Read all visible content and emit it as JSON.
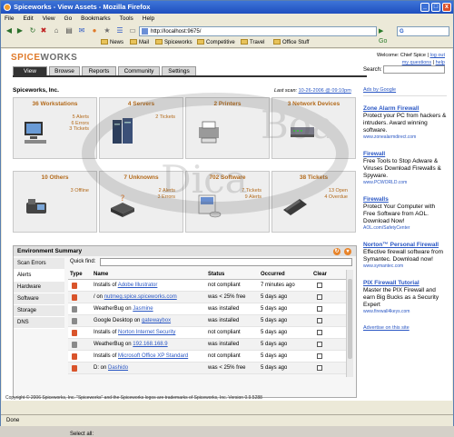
{
  "window": {
    "title": "Spiceworks - View Assets - Mozilla Firefox"
  },
  "menu": [
    "File",
    "Edit",
    "View",
    "Go",
    "Bookmarks",
    "Tools",
    "Help"
  ],
  "nav": {
    "url": "http://localhost:9675/",
    "search_engine": "G",
    "go_label": "Go"
  },
  "bookmarks": [
    "News",
    "Mail",
    "Spiceworks",
    "Competitive",
    "Travel",
    "Office Stuff"
  ],
  "header": {
    "logo_a": "SPICE",
    "logo_b": "WORKS",
    "welcome": "Welcome: Chief Spice |",
    "logout": "log out",
    "questions": "my questions",
    "separator": "|",
    "help": "help",
    "search_label": "Search:"
  },
  "tabs": [
    "View",
    "Browse",
    "Reports",
    "Community",
    "Settings"
  ],
  "org": "Spiceworks, Inc.",
  "last_scan": {
    "label": "Last scan:",
    "value": "10-26-2006 @ 09:10pm"
  },
  "tiles": [
    {
      "title": "36 Workstations",
      "details": [
        "5 Alerts",
        "6 Errors",
        "3 Tickets"
      ]
    },
    {
      "title": "4 Servers",
      "details": [
        "2 Tickets"
      ]
    },
    {
      "title": "2 Printers",
      "details": []
    },
    {
      "title": "3 Network Devices",
      "details": []
    },
    {
      "title": "10 Others",
      "details": [
        "3 Offline"
      ]
    },
    {
      "title": "7 Unknowns",
      "details": [
        "2 Alerts",
        "3 Errors"
      ]
    },
    {
      "title": "702 Software",
      "details": [
        "7 Tickets",
        "9 Alerts"
      ]
    },
    {
      "title": "38 Tickets",
      "details": [
        "13 Open",
        "4 Overdue"
      ]
    }
  ],
  "env": {
    "title": "Environment Summary",
    "sidebar": [
      "Scan Errors",
      "Alerts",
      "Hardware",
      "Software",
      "Storage",
      "DNS"
    ],
    "quick_find": "Quick find:",
    "columns": [
      "Type",
      "Name",
      "Status",
      "Occurred",
      "Clear"
    ],
    "rows": [
      {
        "type": "alert",
        "pre": "Installs of ",
        "link": "Adobe Illustrator",
        "post": "",
        "status": "not compliant",
        "occurred": "7 minutes ago"
      },
      {
        "type": "alert",
        "pre": "/ on ",
        "link": "nutmeg.spice.spiceworks.com",
        "post": "",
        "status": "was < 25% free",
        "occurred": "5 days ago"
      },
      {
        "type": "info",
        "pre": "WeatherBug on ",
        "link": "Jasmine",
        "post": "",
        "status": "was installed",
        "occurred": "5 days ago"
      },
      {
        "type": "info",
        "pre": "Google Desktop on ",
        "link": "gatewaybox",
        "post": "",
        "status": "was installed",
        "occurred": "5 days ago"
      },
      {
        "type": "alert",
        "pre": "Installs of ",
        "link": "Norton Internet Security",
        "post": "",
        "status": "not compliant",
        "occurred": "5 days ago"
      },
      {
        "type": "info",
        "pre": "WeatherBug on ",
        "link": "192.168.168.9",
        "post": "",
        "status": "was installed",
        "occurred": "5 days ago"
      },
      {
        "type": "alert",
        "pre": "Installs of ",
        "link": "Microsoft Office XP Standard",
        "post": "",
        "status": "not compliant",
        "occurred": "5 days ago"
      },
      {
        "type": "alert",
        "pre": "D: on ",
        "link": "Dashido",
        "post": "",
        "status": "was < 25% free",
        "occurred": "5 days ago"
      }
    ],
    "select_all": "Select all:"
  },
  "ads": {
    "by": "Ads by Google",
    "items": [
      {
        "title": "Zone Alarm Firewall",
        "body": "Protect your PC from hackers & intruders. Award winning software.",
        "url": "www.zonealarmdirect.com"
      },
      {
        "title": "Firewall",
        "body": "Free Tools to Stop Adware & Viruses Download Firewalls & Spyware.",
        "url": "www.PCWORLD.com"
      },
      {
        "title": "Firewalls",
        "body": "Protect Your Computer with Free Software from AOL. Download Now!",
        "url": "AOL.com/SafetyCenter"
      },
      {
        "title": "Norton™ Personal Firewall",
        "body": "Effective firewall software from Symantec. Download now!",
        "url": "www.symantec.com"
      },
      {
        "title": "PIX Firewall Tutorial",
        "body": "Master the PIX Firewall and earn Big Bucks as a Security Expert",
        "url": "www.firewall4keys.com"
      }
    ],
    "on_site": "Advertise on this site"
  },
  "copyright": "Copyright © 2006 Spiceworks, Inc. \"Spiceworks\" and the Spiceworks logos are trademarks of Spiceworks, Inc. Version 0.9.5288",
  "status": "Done",
  "watermark": [
    "Boa",
    "Dica"
  ]
}
